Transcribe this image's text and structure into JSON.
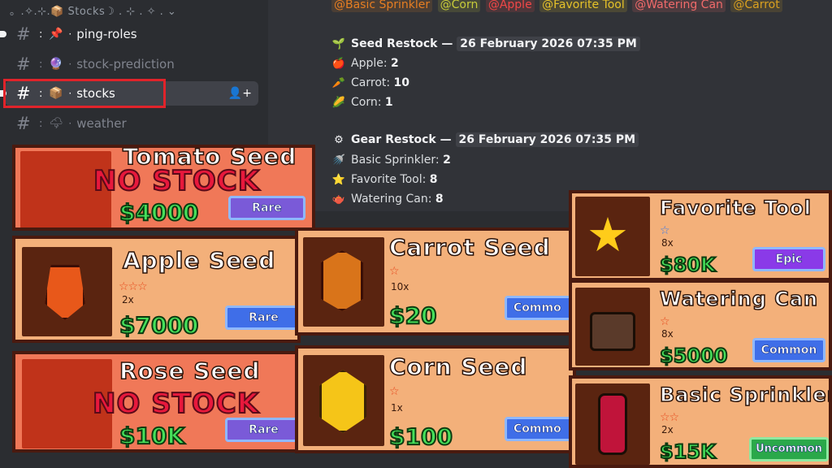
{
  "sidebar": {
    "category": "。.✧.⊹.📦 Stocks☽ . ⊹ . ✧ . ⌄",
    "channels": [
      {
        "name": "ping-roles",
        "emoji": "📌"
      },
      {
        "name": "stock-prediction",
        "emoji": "🔮"
      },
      {
        "name": "stocks",
        "emoji": "📦"
      },
      {
        "name": "weather",
        "emoji": "🌩"
      }
    ]
  },
  "chat": {
    "mentions": [
      "@Basic Sprinkler",
      "@Corn",
      "@Apple",
      "@Favorite Tool",
      "@Watering Can",
      "@Carrot"
    ],
    "mention_colors": [
      "#e67e22",
      "#c8cc3a",
      "#f04747",
      "#e6c229",
      "#f06a6a",
      "#d9a020"
    ],
    "seed": {
      "title": "Seed Restock —",
      "date": "26 February 2026 07:35 PM",
      "items": [
        {
          "label": "Apple:",
          "value": "2"
        },
        {
          "label": "Carrot:",
          "value": "10"
        },
        {
          "label": "Corn:",
          "value": "1"
        }
      ]
    },
    "gear": {
      "title": "Gear Restock —",
      "date": "26 February 2026 07:35 PM",
      "items": [
        {
          "label": "Basic Sprinkler:",
          "value": "2"
        },
        {
          "label": "Favorite Tool:",
          "value": "8"
        },
        {
          "label": "Watering Can:",
          "value": "8"
        }
      ]
    }
  },
  "cards": {
    "tomato": {
      "name": "Tomato Seed",
      "price": "$4000",
      "badge": "Rare",
      "overlay": "NO STOCK"
    },
    "apple": {
      "name": "Apple Seed",
      "qty": "2x",
      "price": "$7000",
      "badge": "Rare"
    },
    "rose": {
      "name": "Rose Seed",
      "price": "$10K",
      "badge": "Rare",
      "overlay": "NO STOCK"
    },
    "carrot": {
      "name": "Carrot Seed",
      "qty": "10x",
      "price": "$20",
      "badge": "Commo"
    },
    "corn": {
      "name": "Corn Seed",
      "qty": "1x",
      "price": "$100",
      "badge": "Commo"
    },
    "favorite": {
      "name": "Favorite Tool",
      "qty": "8x",
      "price": "$80K",
      "badge": "Epic"
    },
    "watering": {
      "name": "Watering Can",
      "qty": "8x",
      "price": "$5000",
      "badge": "Common"
    },
    "sprinkler": {
      "name": "Basic Sprinkler",
      "qty": "2x",
      "price": "$15K",
      "badge": "Uncommon"
    }
  }
}
